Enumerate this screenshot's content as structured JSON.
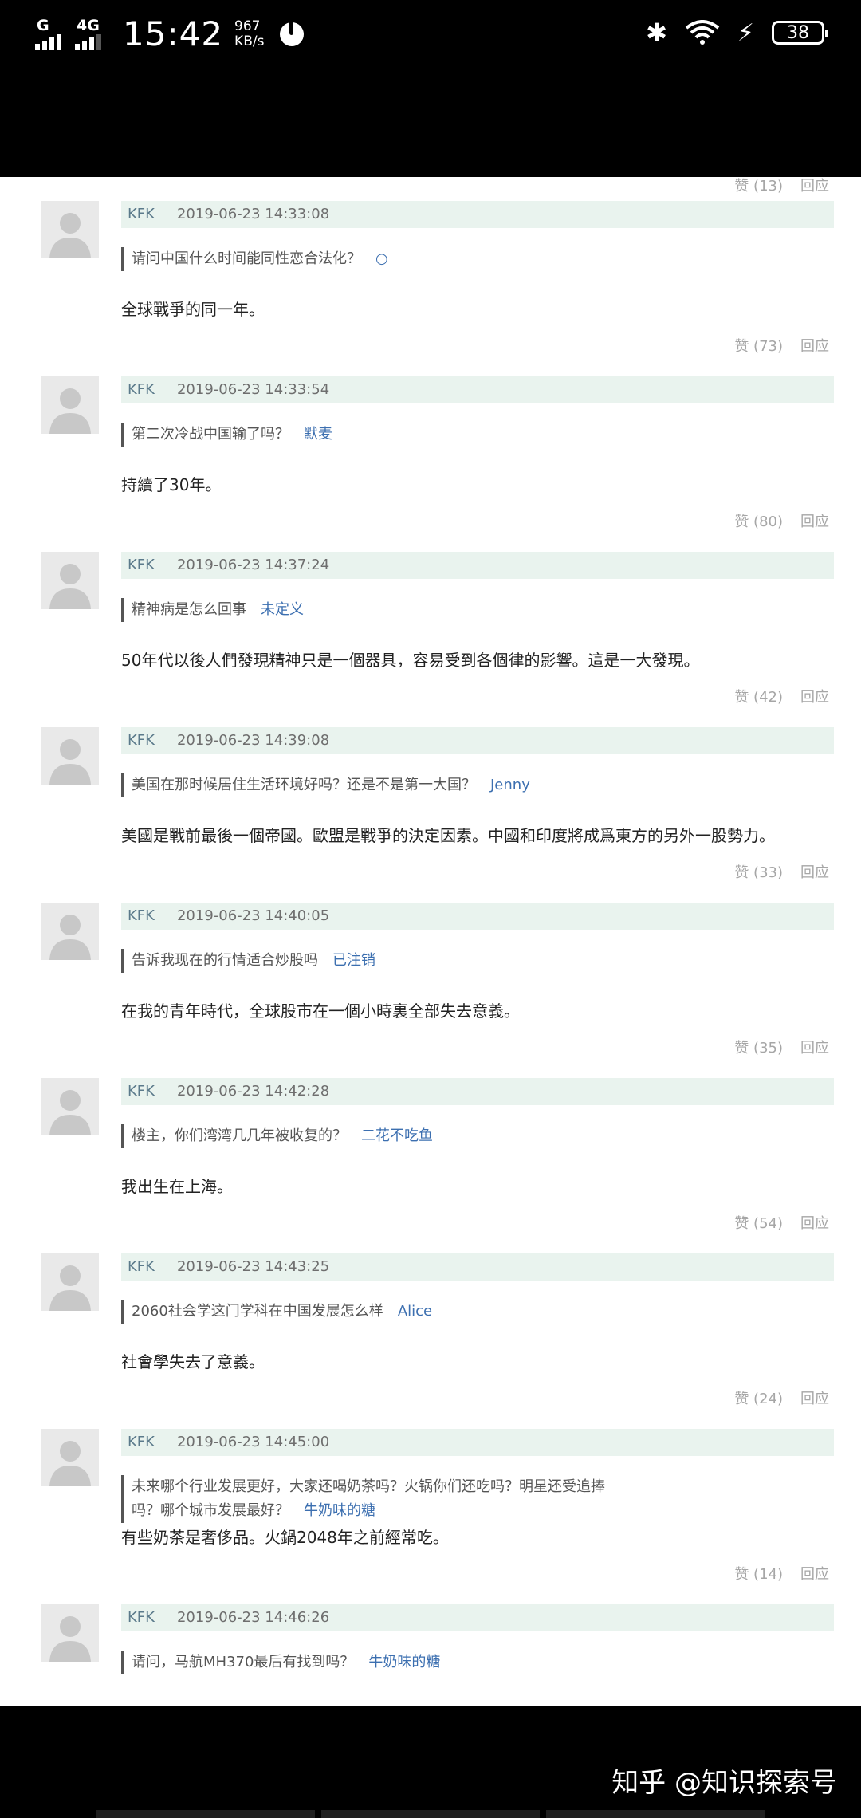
{
  "status_bar": {
    "network": "G",
    "network2": "4G",
    "time": "15:42",
    "speed_value": "967",
    "speed_unit": "KB/s",
    "battery": "38"
  },
  "top_meta": {
    "likes": "赞 (13)",
    "reply": "回应"
  },
  "entries": [
    {
      "user": "KFK",
      "time": "2019-06-23 14:33:08",
      "question": "请问中国什么时间能同性恋合法化？",
      "asker": "○",
      "answer": "全球戰爭的同一年。",
      "likes": "赞 (73)",
      "reply": "回应"
    },
    {
      "user": "KFK",
      "time": "2019-06-23 14:33:54",
      "question": "第二次冷战中国输了吗？",
      "asker": "默麦",
      "answer": "持續了30年。",
      "likes": "赞 (80)",
      "reply": "回应"
    },
    {
      "user": "KFK",
      "time": "2019-06-23 14:37:24",
      "question": "精神病是怎么回事",
      "asker": "未定义",
      "answer": "50年代以後人們發現精神只是一個器具，容易受到各個律的影響。這是一大發現。",
      "likes": "赞 (42)",
      "reply": "回应"
    },
    {
      "user": "KFK",
      "time": "2019-06-23 14:39:08",
      "question": "美国在那时候居住生活环境好吗？还是不是第一大国？",
      "asker": "Jenny",
      "answer": "美國是戰前最後一個帝國。歐盟是戰爭的決定因素。中國和印度將成爲東方的另外一股勢力。",
      "likes": "赞 (33)",
      "reply": "回应"
    },
    {
      "user": "KFK",
      "time": "2019-06-23 14:40:05",
      "question": "告诉我现在的行情适合炒股吗",
      "asker": "已注销",
      "answer": "在我的青年時代，全球股市在一個小時裏全部失去意義。",
      "likes": "赞 (35)",
      "reply": "回应"
    },
    {
      "user": "KFK",
      "time": "2019-06-23 14:42:28",
      "question": "楼主，你们湾湾几几年被收复的？",
      "asker": "二花不吃鱼",
      "answer": "我出生在上海。",
      "likes": "赞 (54)",
      "reply": "回应"
    },
    {
      "user": "KFK",
      "time": "2019-06-23 14:43:25",
      "question": "2060社会学这门学科在中国发展怎么样",
      "asker": "Alice",
      "answer": "社會學失去了意義。",
      "likes": "赞 (24)",
      "reply": "回应"
    },
    {
      "user": "KFK",
      "time": "2019-06-23 14:45:00",
      "question": "未来哪个行业发展更好，大家还喝奶茶吗？火锅你们还吃吗？明星还受追捧吗？哪个城市发展最好？",
      "asker": "牛奶味的糖",
      "answer": "有些奶茶是奢侈品。火鍋2048年之前經常吃。",
      "likes": "赞 (14)",
      "reply": "回应"
    },
    {
      "user": "KFK",
      "time": "2019-06-23 14:46:26",
      "question": "请问，马航MH370最后有找到吗？",
      "asker": "牛奶味的糖",
      "answer": "",
      "likes": "",
      "reply": ""
    }
  ],
  "watermark": "知乎 @知识探索号"
}
